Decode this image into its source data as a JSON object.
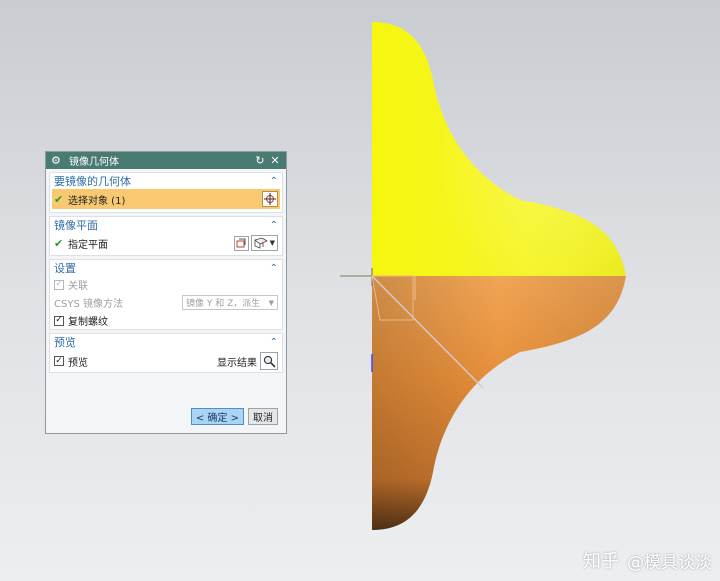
{
  "dialog": {
    "title": "镜像几何体",
    "sections": {
      "geometry": {
        "header": "要镜像的几何体",
        "select_label": "选择对象 (1)"
      },
      "plane": {
        "header": "镜像平面",
        "label": "指定平面"
      },
      "settings": {
        "header": "设置",
        "associative_label": "关联",
        "csys_label": "CSYS 镜像方法",
        "csys_value": "镜像 Y 和 Z，派生",
        "copy_threads_label": "复制螺纹"
      },
      "preview": {
        "header": "预览",
        "preview_label": "预览",
        "show_result_label": "显示结果"
      }
    },
    "buttons": {
      "ok": "< 确定 >",
      "cancel": "取消"
    }
  },
  "watermark": {
    "site": "知乎",
    "handle": "@模具谈淡"
  },
  "colors": {
    "title_bar": "#4a7b72",
    "section_header": "#2f6fa8",
    "selected_row": "#f8c971",
    "yellow_body": "#f5f516",
    "orange_body": "#e38f3c"
  },
  "icons": {
    "gear": "gear-icon",
    "reset": "reset-icon",
    "close": "close-icon",
    "collapse": "chevron-up-icon",
    "crosshair": "crosshair-icon",
    "plane": "plane-icon",
    "magnifier": "magnifier-icon"
  }
}
